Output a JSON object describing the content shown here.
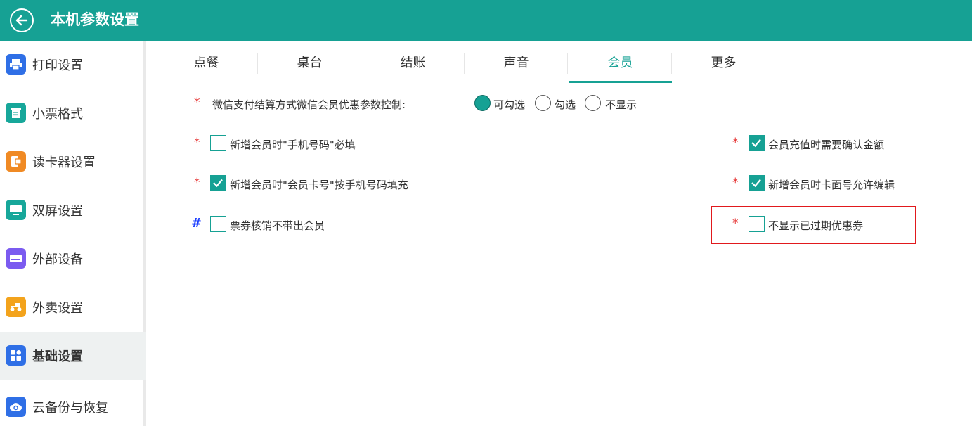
{
  "header": {
    "title": "本机参数设置"
  },
  "sidebar": {
    "items": [
      {
        "label": "打印设置",
        "icon": "printer-icon",
        "color": "#2f6fe6"
      },
      {
        "label": "小票格式",
        "icon": "receipt-icon",
        "color": "#17a79a"
      },
      {
        "label": "读卡器设置",
        "icon": "card-reader-icon",
        "color": "#f08a24"
      },
      {
        "label": "双屏设置",
        "icon": "monitor-icon",
        "color": "#17a79a"
      },
      {
        "label": "外部设备",
        "icon": "device-icon",
        "color": "#7b5bf0"
      },
      {
        "label": "外卖设置",
        "icon": "delivery-icon",
        "color": "#f3a31c"
      },
      {
        "label": "基础设置",
        "icon": "grid-icon",
        "color": "#2f6fe6"
      },
      {
        "label": "云备份与恢复",
        "icon": "cloud-backup-icon",
        "color": "#2f6fe6"
      }
    ],
    "active_index": 6
  },
  "tabs": [
    "点餐",
    "桌台",
    "结账",
    "声音",
    "会员",
    "更多"
  ],
  "active_tab": "会员",
  "settings": {
    "wechat_row": {
      "marker": "*",
      "label": "微信支付结算方式微信会员优惠参数控制:",
      "options": [
        "可勾选",
        "勾选",
        "不显示"
      ],
      "selected": "可勾选"
    },
    "left": [
      {
        "marker": "*",
        "label": "新增会员时\"手机号码\"必填",
        "checked": false
      },
      {
        "marker": "*",
        "label": "新增会员时\"会员卡号\"按手机号码填充",
        "checked": true
      },
      {
        "marker": "#",
        "label": "票券核销不带出会员",
        "checked": false
      }
    ],
    "right": [
      {
        "marker": "*",
        "label": "会员充值时需要确认金额",
        "checked": true
      },
      {
        "marker": "*",
        "label": "新增会员时卡面号允许编辑",
        "checked": true
      },
      {
        "marker": "*",
        "label": "不显示已过期优惠券",
        "checked": false
      }
    ]
  },
  "colors": {
    "accent": "#16a194",
    "required": "#e53030",
    "hash": "#1e40ff",
    "highlight": "#e1191d"
  }
}
